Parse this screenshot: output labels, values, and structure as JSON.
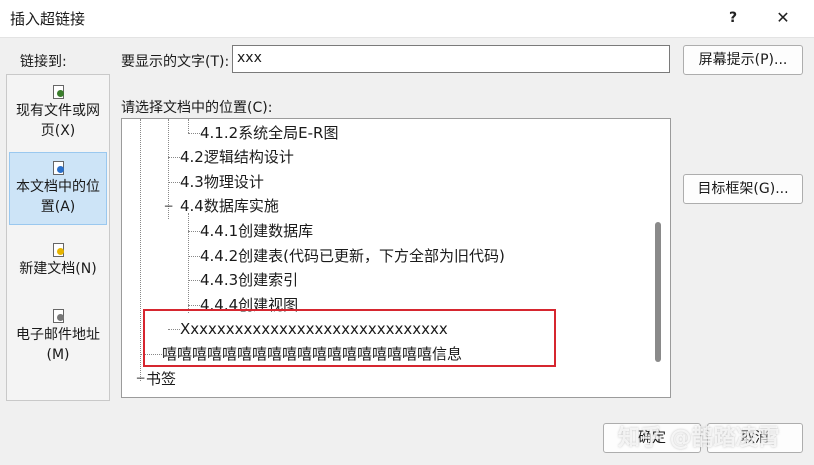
{
  "window": {
    "title": "插入超链接",
    "help": "?",
    "close": "✕"
  },
  "linkbar": {
    "label": "链接到:",
    "items": [
      {
        "label": "现有文件或网页(X)",
        "line1": "现有文件或网",
        "line2": "页(X)",
        "icon": "existing-file-icon"
      },
      {
        "label": "本文档中的位置(A)",
        "line1": "本文档中的位",
        "line2": "置(A)",
        "icon": "place-in-document-icon"
      },
      {
        "label": "新建文档(N)",
        "line1": "新建文档(N)",
        "line2": "",
        "icon": "new-document-icon"
      },
      {
        "label": "电子邮件地址(M)",
        "line1": "电子邮件地址",
        "line2": "(M)",
        "icon": "email-icon"
      }
    ]
  },
  "display_text": {
    "label": "要显示的文字(T):",
    "value": "xxx"
  },
  "screen_tip_button": "屏幕提示(P)...",
  "choose_label": "请选择文档中的位置(C):",
  "target_frame_button": "目标框架(G)...",
  "tree": [
    "4.1.2系统全局E-R图",
    "4.2逻辑结构设计",
    "4.3物理设计",
    "4.4数据库实施",
    "4.4.1创建数据库",
    "4.4.2创建表(代码已更新，下方全部为旧代码)",
    "4.4.3创建索引",
    "4.4.4创建视图",
    "Xxxxxxxxxxxxxxxxxxxxxxxxxxxxxx",
    "嘻嘻嘻嘻嘻嘻嘻嘻嘻嘻嘻嘻嘻嘻嘻嘻嘻嘻信息",
    "书签"
  ],
  "tree_expanders": {
    "collapse": "−"
  },
  "ok_button": "确定",
  "cancel_button": "取消",
  "watermark": "知乎 @鹊踏凌霄",
  "colors": {
    "selection": "#cde4f7",
    "highlight": "#d6262f"
  }
}
